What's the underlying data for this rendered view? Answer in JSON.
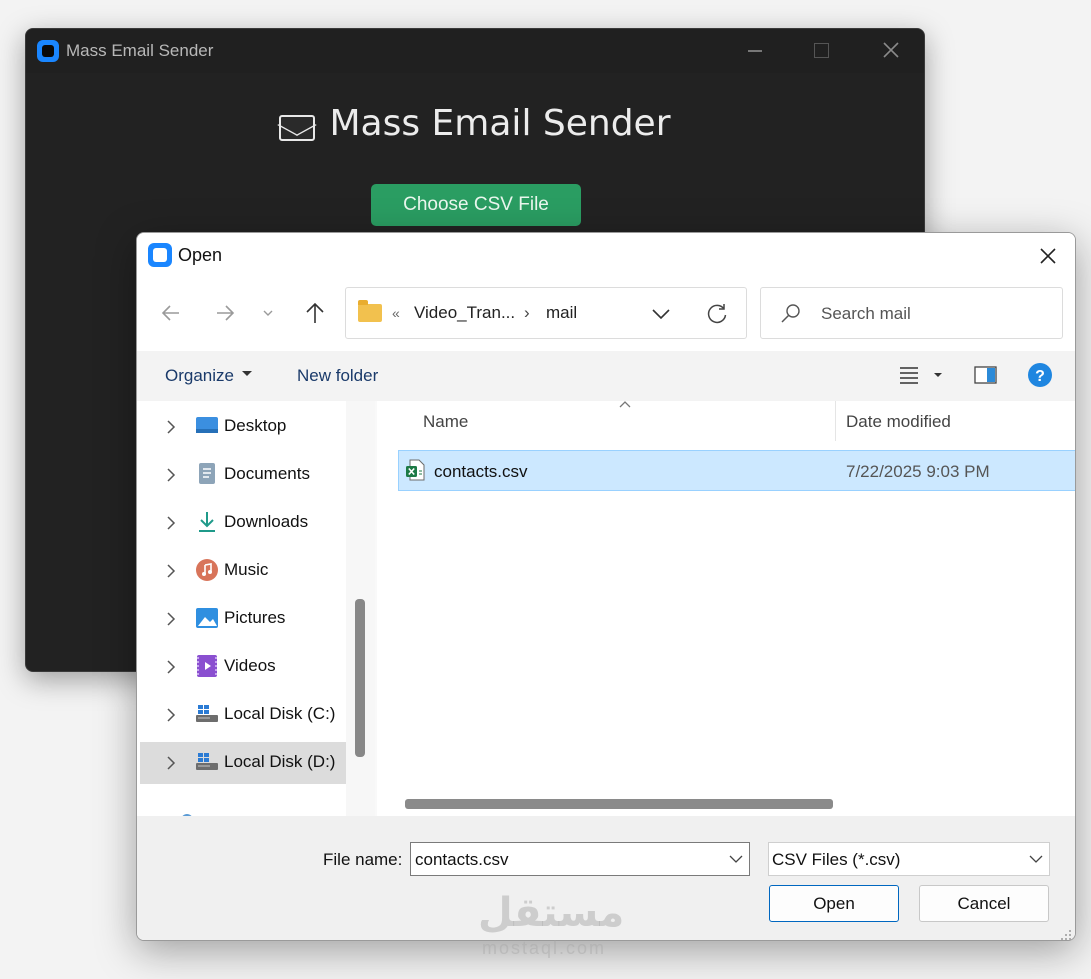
{
  "app": {
    "window_title": "Mass Email Sender",
    "heading": "Mass Email Sender",
    "choose_button": "Choose CSV File",
    "accent_color": "#2a9d62"
  },
  "dialog": {
    "title": "Open",
    "breadcrumb": {
      "overflow": "«",
      "parent": "Video_Tran...",
      "separator": "›",
      "current": "mail"
    },
    "search_placeholder": "Search mail",
    "toolbar": {
      "organize": "Organize",
      "new_folder": "New folder"
    },
    "nav_items": [
      {
        "label": "Desktop",
        "icon": "desktop-icon"
      },
      {
        "label": "Documents",
        "icon": "documents-icon"
      },
      {
        "label": "Downloads",
        "icon": "downloads-icon"
      },
      {
        "label": "Music",
        "icon": "music-icon"
      },
      {
        "label": "Pictures",
        "icon": "pictures-icon"
      },
      {
        "label": "Videos",
        "icon": "videos-icon"
      },
      {
        "label": "Local Disk (C:)",
        "icon": "drive-icon"
      },
      {
        "label": "Local Disk (D:)",
        "icon": "drive-icon",
        "selected": true
      }
    ],
    "columns": {
      "name": "Name",
      "date": "Date modified"
    },
    "files": [
      {
        "name": "contacts.csv",
        "date": "7/22/2025 9:03 PM",
        "icon": "excel-csv-icon",
        "selected": true
      }
    ],
    "footer": {
      "file_name_label": "File name:",
      "file_name_value": "contacts.csv",
      "file_type": "CSV Files (*.csv)",
      "open_button": "Open",
      "cancel_button": "Cancel"
    }
  },
  "watermark": {
    "text": "مستقل",
    "sub": "mostaql.com"
  }
}
